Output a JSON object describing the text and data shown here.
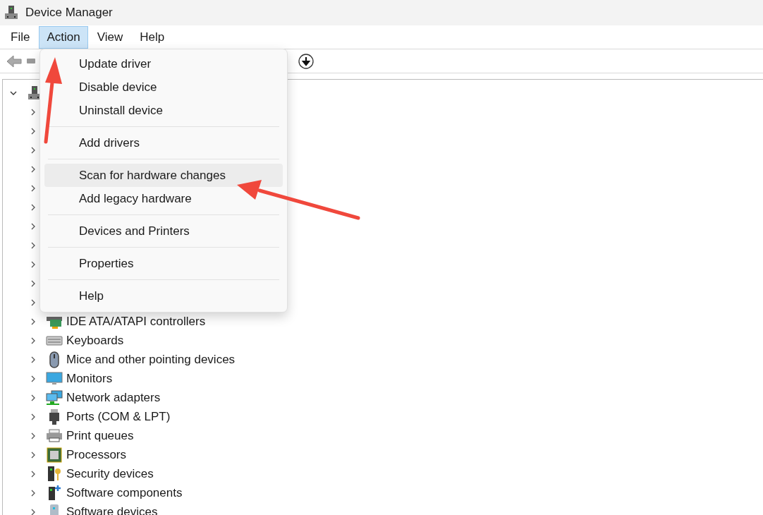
{
  "window": {
    "title": "Device Manager"
  },
  "menu_bar": [
    {
      "label": "File",
      "selected": false
    },
    {
      "label": "Action",
      "selected": true
    },
    {
      "label": "View",
      "selected": false
    },
    {
      "label": "Help",
      "selected": false
    }
  ],
  "action_menu": [
    {
      "kind": "item",
      "label": "Update driver",
      "selected": false
    },
    {
      "kind": "item",
      "label": "Disable device",
      "selected": false
    },
    {
      "kind": "item",
      "label": "Uninstall device",
      "selected": false
    },
    {
      "kind": "separator"
    },
    {
      "kind": "item",
      "label": "Add drivers",
      "selected": false
    },
    {
      "kind": "separator"
    },
    {
      "kind": "item",
      "label": "Scan for hardware changes",
      "selected": true
    },
    {
      "kind": "item",
      "label": "Add legacy hardware",
      "selected": false
    },
    {
      "kind": "separator"
    },
    {
      "kind": "item",
      "label": "Devices and Printers",
      "selected": false
    },
    {
      "kind": "separator"
    },
    {
      "kind": "item",
      "label": "Properties",
      "selected": false
    },
    {
      "kind": "separator"
    },
    {
      "kind": "item",
      "label": "Help",
      "selected": false
    }
  ],
  "tree": {
    "expanded": true,
    "children": [
      {
        "expanded": false
      },
      {
        "expanded": false
      },
      {
        "expanded": false
      },
      {
        "expanded": false
      },
      {
        "expanded": false
      },
      {
        "expanded": false
      },
      {
        "expanded": false
      },
      {
        "expanded": false
      },
      {
        "expanded": false
      },
      {
        "expanded": false
      },
      {
        "expanded": false
      },
      {
        "label": "IDE ATA/ATAPI controllers",
        "expanded": false
      },
      {
        "label": "Keyboards",
        "expanded": false
      },
      {
        "label": "Mice and other pointing devices",
        "expanded": false
      },
      {
        "label": "Monitors",
        "expanded": false
      },
      {
        "label": "Network adapters",
        "expanded": false
      },
      {
        "label": "Ports (COM & LPT)",
        "expanded": false
      },
      {
        "label": "Print queues",
        "expanded": false
      },
      {
        "label": "Processors",
        "expanded": false
      },
      {
        "label": "Security devices",
        "expanded": false
      },
      {
        "label": "Software components",
        "expanded": false
      },
      {
        "label": "Software devices",
        "expanded": false
      }
    ]
  }
}
